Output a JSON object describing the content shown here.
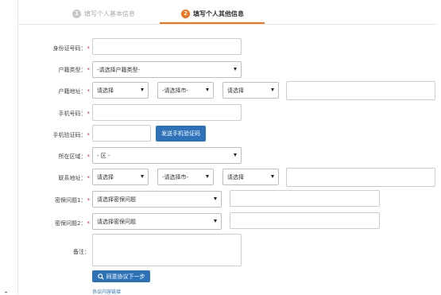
{
  "steps": [
    {
      "num": "1",
      "label": "填写个人基本信息"
    },
    {
      "num": "2",
      "label": "填写个人其他信息"
    }
  ],
  "form": {
    "id_number": {
      "label": "身份证号码：",
      "required": "*",
      "value": ""
    },
    "household_type": {
      "label": "户籍类型：",
      "required": "*",
      "selected": "-请选择户籍类型-"
    },
    "household_address": {
      "label": "户籍地址：",
      "required": "*",
      "province": "请选择",
      "city": "-请选择市-",
      "district": "请选择",
      "detail": ""
    },
    "phone": {
      "label": "手机号码：",
      "required": "*",
      "value": ""
    },
    "phone_code": {
      "label": "手机验证码：",
      "required": "*",
      "value": "",
      "send_button": "发送手机验证码"
    },
    "area": {
      "label": "所在区域：",
      "required": "*",
      "selected": "- 区 -"
    },
    "contact_address": {
      "label": "联系地址：",
      "required": "*",
      "province": "请选择",
      "city": "-请选择市-",
      "district": "请选择",
      "detail": ""
    },
    "security_q1": {
      "label": "密保问题1：",
      "required": "*",
      "selected": "请选择密保问题",
      "answer": ""
    },
    "security_q2": {
      "label": "密保问题2：",
      "required": "*",
      "selected": "请选择密保问题",
      "answer": ""
    },
    "remark": {
      "label": "备注：",
      "value": ""
    }
  },
  "actions": {
    "agree_next": "同意协议下一步",
    "agreement_link": "协议内容链接"
  }
}
